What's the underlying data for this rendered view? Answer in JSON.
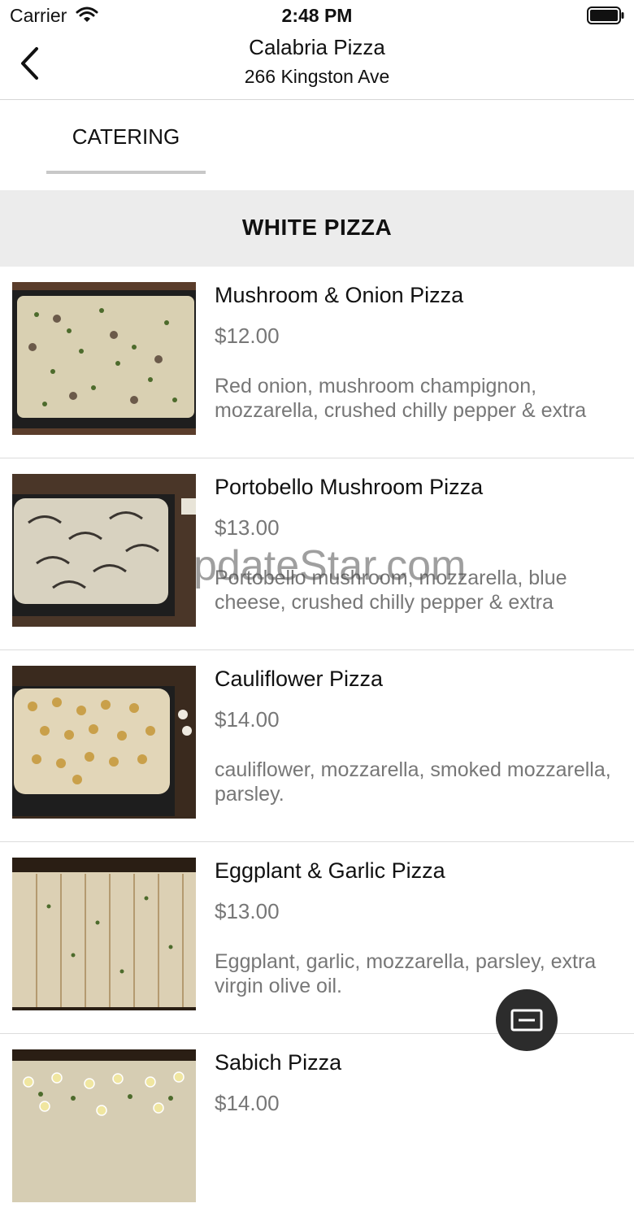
{
  "status_bar": {
    "carrier": "Carrier",
    "time": "2:48 PM"
  },
  "header": {
    "title": "Calabria Pizza",
    "subtitle": "266 Kingston Ave"
  },
  "tabs": [
    {
      "label": "CATERING"
    }
  ],
  "section": {
    "title": "WHITE PIZZA"
  },
  "items": [
    {
      "name": "Mushroom & Onion Pizza",
      "price": "$12.00",
      "description": "Red onion, mushroom champignon, mozzarella, crushed chilly pepper & extra"
    },
    {
      "name": "Portobello Mushroom Pizza",
      "price": "$13.00",
      "description": "Portobello mushroom, mozzarella, blue cheese, crushed chilly pepper & extra"
    },
    {
      "name": "Cauliflower Pizza",
      "price": "$14.00",
      "description": "cauliflower, mozzarella, smoked mozzarella, parsley."
    },
    {
      "name": "Eggplant & Garlic Pizza",
      "price": "$13.00",
      "description": "Eggplant, garlic, mozzarella, parsley, extra virgin olive oil."
    },
    {
      "name": "Sabich Pizza",
      "price": "$14.00",
      "description": ""
    }
  ],
  "watermark": "pdateStar.com",
  "icons": {
    "back": "chevron-left-icon",
    "fab": "minimize-icon",
    "wifi": "wifi-icon",
    "battery": "battery-icon"
  }
}
